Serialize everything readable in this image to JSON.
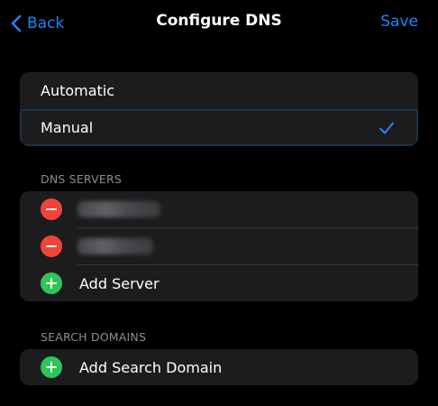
{
  "nav": {
    "back_label": "Back",
    "title": "Configure DNS",
    "save_label": "Save"
  },
  "mode": {
    "options": [
      {
        "label": "Automatic",
        "selected": false
      },
      {
        "label": "Manual",
        "selected": true
      }
    ]
  },
  "dns_servers": {
    "header": "DNS SERVERS",
    "servers": [
      {
        "value": "",
        "redacted": true
      },
      {
        "value": "",
        "redacted": true
      }
    ],
    "add_label": "Add Server"
  },
  "search_domains": {
    "header": "SEARCH DOMAINS",
    "add_label": "Add Search Domain"
  },
  "colors": {
    "accent": "#1e86f7",
    "remove": "#f0443a",
    "add": "#2fc55a",
    "group_bg": "#1c1c1e",
    "section_text": "#8d8d92"
  }
}
